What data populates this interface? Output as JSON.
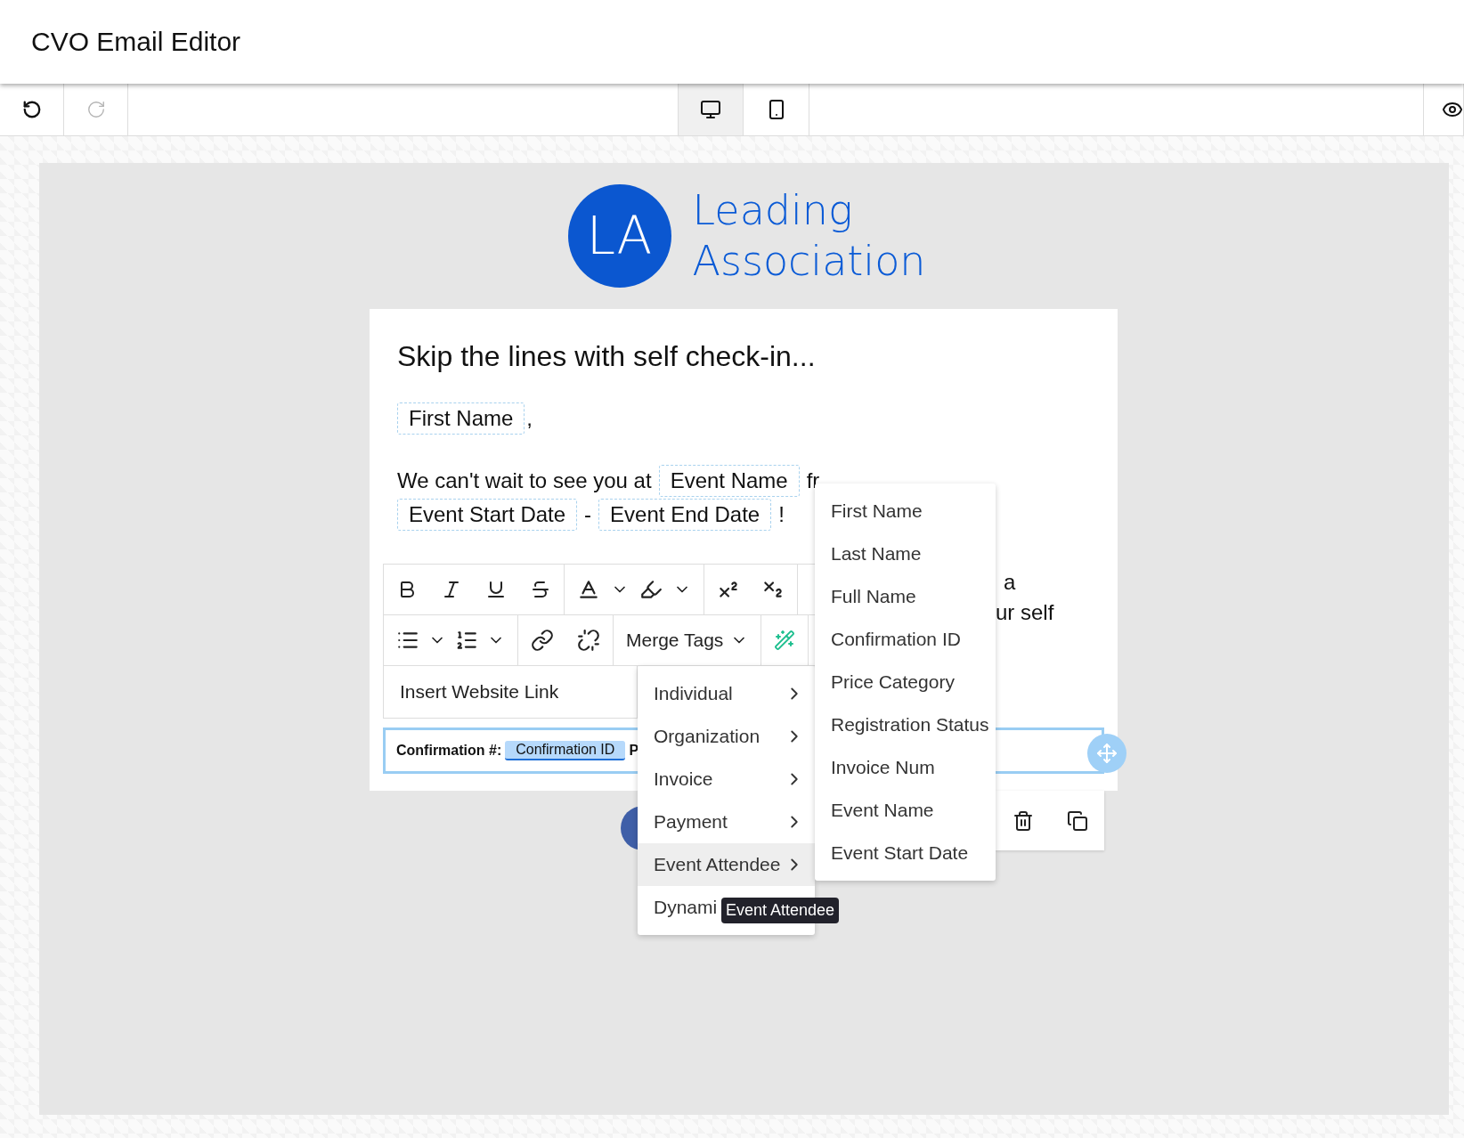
{
  "app": {
    "title": "CVO Email Editor"
  },
  "history": [
    {
      "kind": "undo",
      "disabled": false
    },
    {
      "kind": "redo",
      "disabled": true
    }
  ],
  "devices": [
    {
      "kind": "desktop",
      "selected": true
    },
    {
      "kind": "mobile",
      "selected": false
    }
  ],
  "logo": {
    "initials": "LA",
    "name_lines": [
      "Leading",
      "Association"
    ]
  },
  "email": {
    "heading": "Skip the lines with self check-in...",
    "greeting": {
      "tag": "First Name",
      "after": ","
    },
    "lines": [
      [
        {
          "kind": "text",
          "text": "We can't wait to see you at"
        },
        {
          "kind": "tag",
          "text": "Event Name"
        },
        {
          "kind": "text",
          "text": "fr"
        }
      ],
      [
        {
          "kind": "tag",
          "text": "Event Start Date"
        },
        {
          "kind": "text",
          "text": "-"
        },
        {
          "kind": "tag",
          "text": "Event End Date"
        },
        {
          "kind": "text",
          "text": "!"
        }
      ]
    ],
    "covered_lines": [
      "a",
      "ur self"
    ],
    "confirmation": {
      "label": "Confirmation #:",
      "tag": "Confirmation ID",
      "next": "P"
    }
  },
  "format_toolbar": {
    "merge_tags": "Merge Tags",
    "link_field": {
      "placeholder": "Insert Website Link"
    }
  },
  "merge_menu": {
    "items": [
      {
        "label": "Individual",
        "selected": false
      },
      {
        "label": "Organization",
        "selected": false
      },
      {
        "label": "Invoice",
        "selected": false
      },
      {
        "label": "Payment",
        "selected": false
      },
      {
        "label": "Event Attendee",
        "selected": true
      },
      {
        "label": "Dynami",
        "selected": false
      }
    ]
  },
  "submenu": {
    "items": [
      "First Name",
      "Last Name",
      "Full Name",
      "Confirmation ID",
      "Price Category",
      "Registration Status",
      "Invoice Num",
      "Event Name",
      "Event Start Date"
    ]
  },
  "tooltip": "Event Attendee"
}
